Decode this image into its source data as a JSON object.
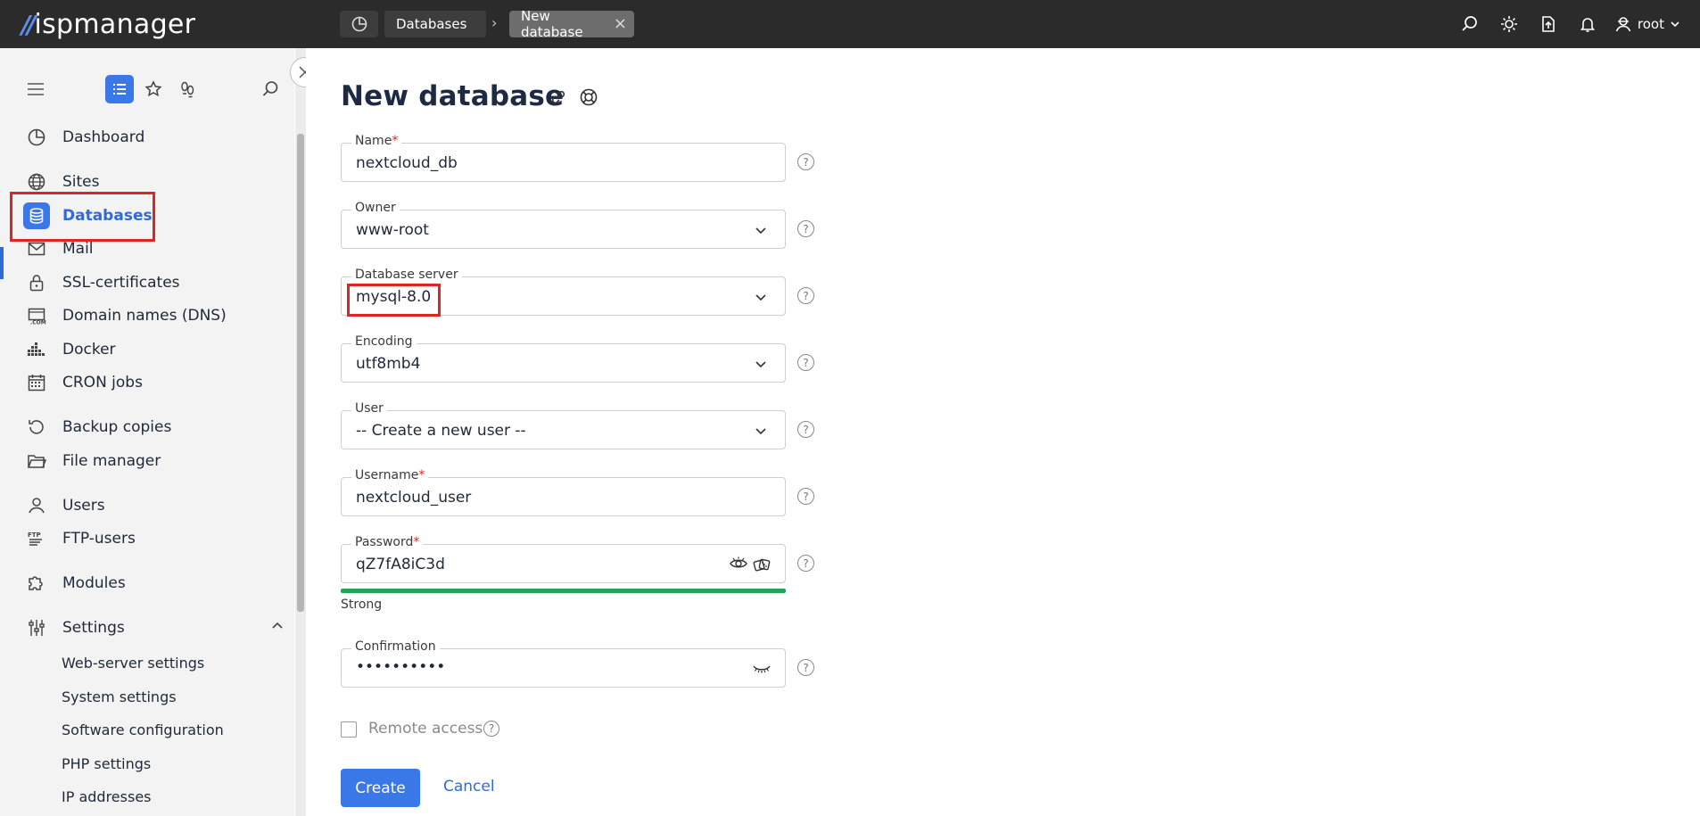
{
  "app": {
    "logo_text": "ispmanager"
  },
  "breadcrumbs": [
    {
      "label": "Databases"
    },
    {
      "label": "New database"
    }
  ],
  "topbar": {
    "user_label": "root"
  },
  "sidebar": {
    "items": [
      {
        "label": "Dashboard",
        "icon": "dashboard-icon"
      },
      {
        "label": "Sites",
        "icon": "globe-icon"
      },
      {
        "label": "Databases",
        "icon": "database-icon",
        "active": true
      },
      {
        "label": "Mail",
        "icon": "mail-icon"
      },
      {
        "label": "SSL-certificates",
        "icon": "lock-icon"
      },
      {
        "label": "Domain names (DNS)",
        "icon": "dns-icon"
      },
      {
        "label": "Docker",
        "icon": "docker-icon"
      },
      {
        "label": "CRON jobs",
        "icon": "calendar-icon"
      },
      {
        "label": "Backup copies",
        "icon": "backup-icon"
      },
      {
        "label": "File manager",
        "icon": "folder-icon"
      },
      {
        "label": "Users",
        "icon": "user-icon"
      },
      {
        "label": "FTP-users",
        "icon": "ftp-icon"
      },
      {
        "label": "Modules",
        "icon": "puzzle-icon"
      },
      {
        "label": "Settings",
        "icon": "settings-icon",
        "expanded": true
      }
    ],
    "settings_sub": [
      {
        "label": "Web-server settings"
      },
      {
        "label": "System settings"
      },
      {
        "label": "Software configuration"
      },
      {
        "label": "PHP settings"
      },
      {
        "label": "IP addresses"
      }
    ]
  },
  "form": {
    "title": "New database",
    "name": {
      "label": "Name",
      "value": "nextcloud_db"
    },
    "owner": {
      "label": "Owner",
      "value": "www-root"
    },
    "server": {
      "label": "Database server",
      "value": "mysql-8.0"
    },
    "encoding": {
      "label": "Encoding",
      "value": "utf8mb4"
    },
    "user": {
      "label": "User",
      "value": "-- Create a new user --"
    },
    "username": {
      "label": "Username",
      "value": "nextcloud_user"
    },
    "password": {
      "label": "Password",
      "value": "qZ7fA8iC3d",
      "strength": "Strong"
    },
    "confirmation": {
      "label": "Confirmation",
      "value": "••••••••••"
    },
    "remote_access": {
      "label": "Remote access",
      "checked": false
    },
    "required_mark": "*",
    "help_glyph": "?",
    "create_label": "Create",
    "cancel_label": "Cancel"
  },
  "colors": {
    "accent": "#3b78e7",
    "topbar": "#2b2b2b",
    "highlight": "#e02424",
    "strength": "#22a35a"
  }
}
